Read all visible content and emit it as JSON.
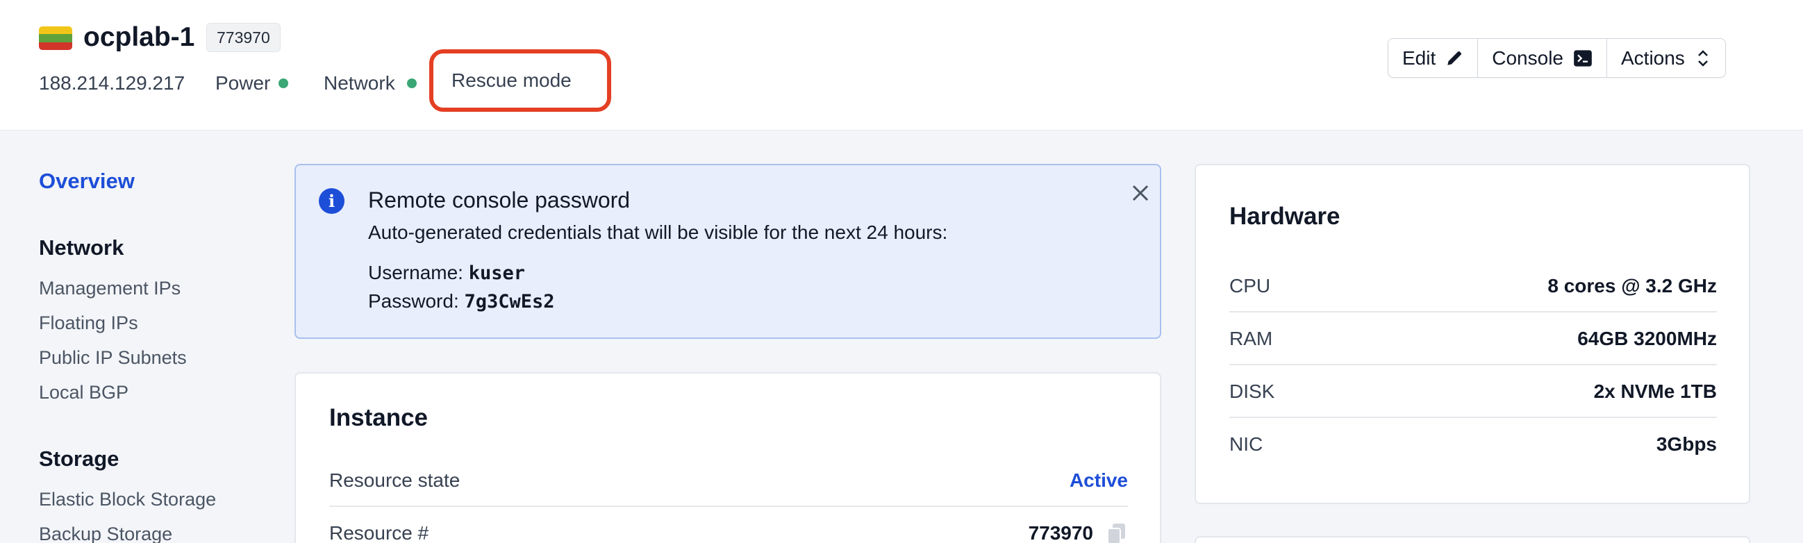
{
  "header": {
    "hostname": "ocplab-1",
    "id_badge": "773970",
    "ip": "188.214.129.217",
    "power_label": "Power",
    "network_label": "Network",
    "rescue_label": "Rescue mode",
    "status_color": "#3aa774",
    "flag_colors": [
      "#f2c618",
      "#5fa23b",
      "#d2352a"
    ],
    "actions": {
      "edit": "Edit",
      "console": "Console",
      "actions": "Actions"
    }
  },
  "sidebar": {
    "active": "Overview",
    "sections": [
      {
        "title": "Network",
        "items": [
          "Management IPs",
          "Floating IPs",
          "Public IP Subnets",
          "Local BGP"
        ]
      },
      {
        "title": "Storage",
        "items": [
          "Elastic Block Storage",
          "Backup Storage"
        ]
      }
    ]
  },
  "alert": {
    "title": "Remote console password",
    "description": "Auto-generated credentials that will be visible for the next 24 hours:",
    "username_label": "Username:",
    "username": "kuser",
    "password_label": "Password:",
    "password": "7g3CwEs2"
  },
  "instance": {
    "title": "Instance",
    "rows": [
      {
        "label": "Resource state",
        "value": "Active"
      },
      {
        "label": "Resource #",
        "value": "773970"
      }
    ]
  },
  "hardware": {
    "title": "Hardware",
    "rows": [
      {
        "label": "CPU",
        "value": "8 cores @ 3.2 GHz"
      },
      {
        "label": "RAM",
        "value": "64GB 3200MHz"
      },
      {
        "label": "DISK",
        "value": "2x NVMe 1TB"
      },
      {
        "label": "NIC",
        "value": "3Gbps"
      }
    ]
  }
}
